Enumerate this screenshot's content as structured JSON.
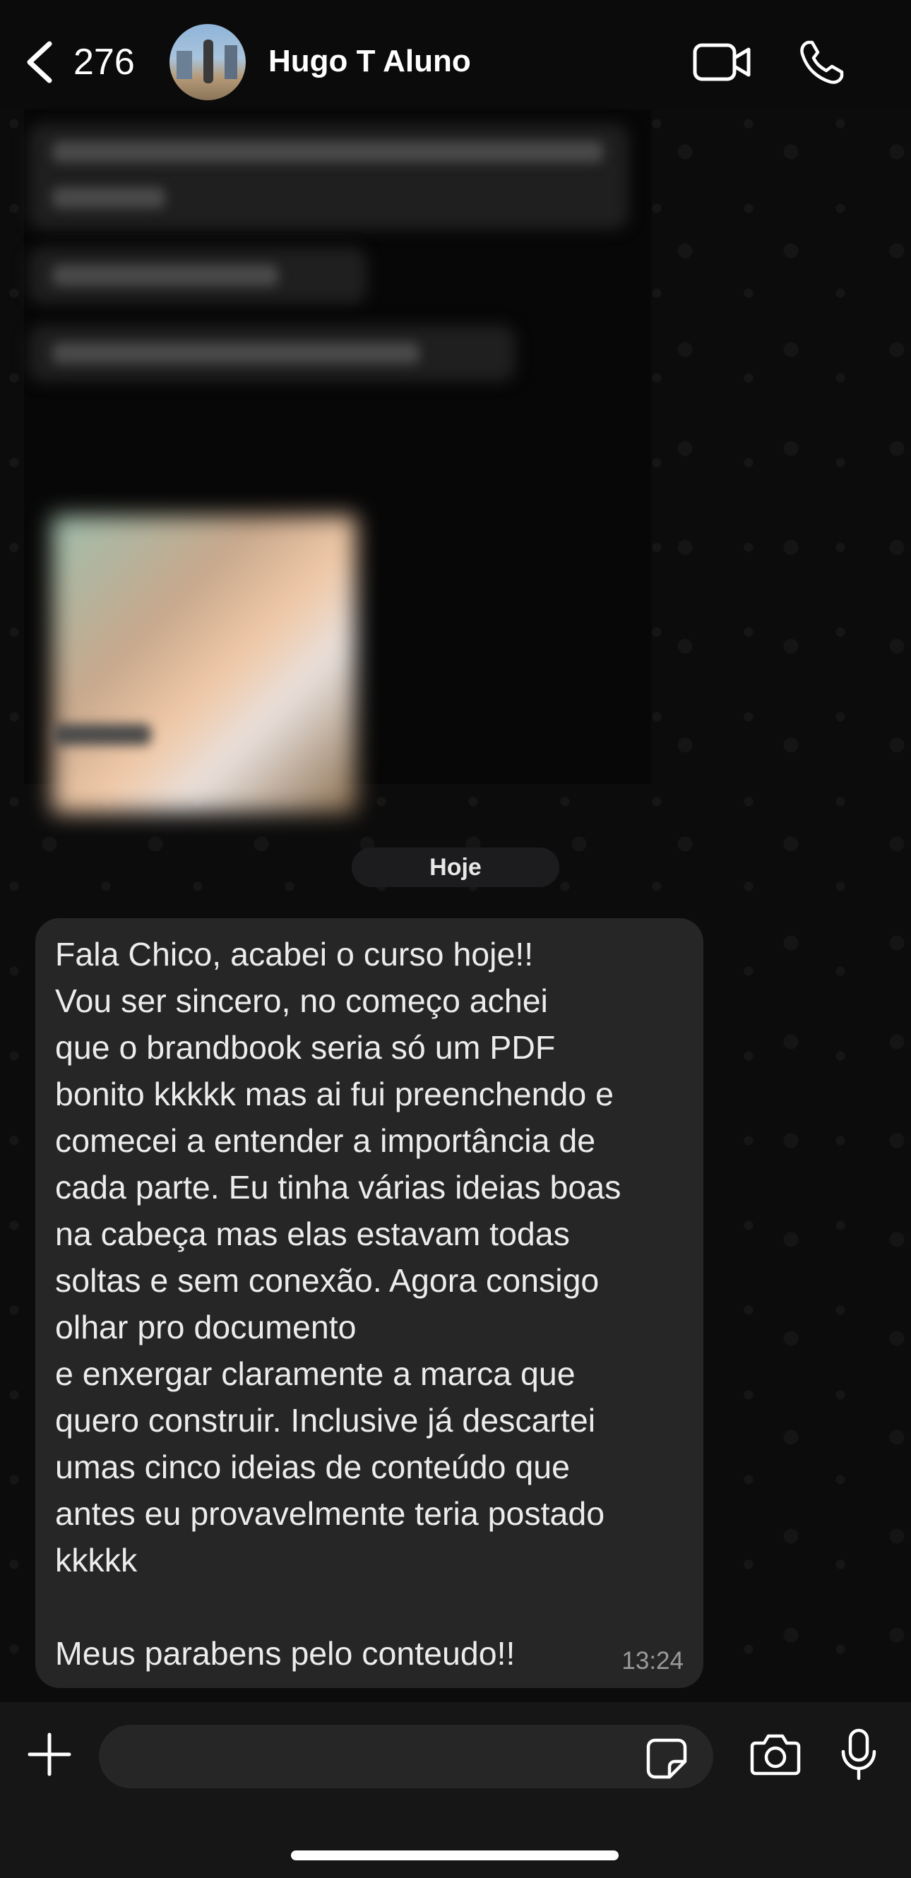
{
  "header": {
    "back_count": "276",
    "contact_name": "Hugo T Aluno"
  },
  "chat": {
    "date_separator": "Hoje",
    "message": {
      "text": "Fala Chico, acabei o curso hoje!!\nVou ser sincero, no começo achei\nque o brandbook seria só um PDF\nbonito kkkkk mas ai fui preenchendo e\ncomecei a entender a importância de\ncada parte. Eu tinha várias ideias boas\nna cabeça mas elas estavam todas\nsoltas e sem conexão. Agora consigo\nolhar pro documento\ne enxergar claramente a marca que\nquero construir. Inclusive já descartei\numas cinco ideias de conteúdo que\nantes eu provavelmente teria postado\nkkkkk\n\nMeus parabens pelo conteudo!!",
      "time": "13:24"
    }
  },
  "input": {
    "value": "",
    "placeholder": ""
  },
  "icons": {
    "back": "chevron-left-icon",
    "video": "video-camera-icon",
    "call": "phone-icon",
    "attach": "plus-icon",
    "sticker": "sticker-icon",
    "camera": "camera-icon",
    "mic": "microphone-icon"
  },
  "colors": {
    "background": "#0b0b0b",
    "bubble": "#262626",
    "text": "#ececec",
    "timestamp": "#9a9a9a"
  }
}
